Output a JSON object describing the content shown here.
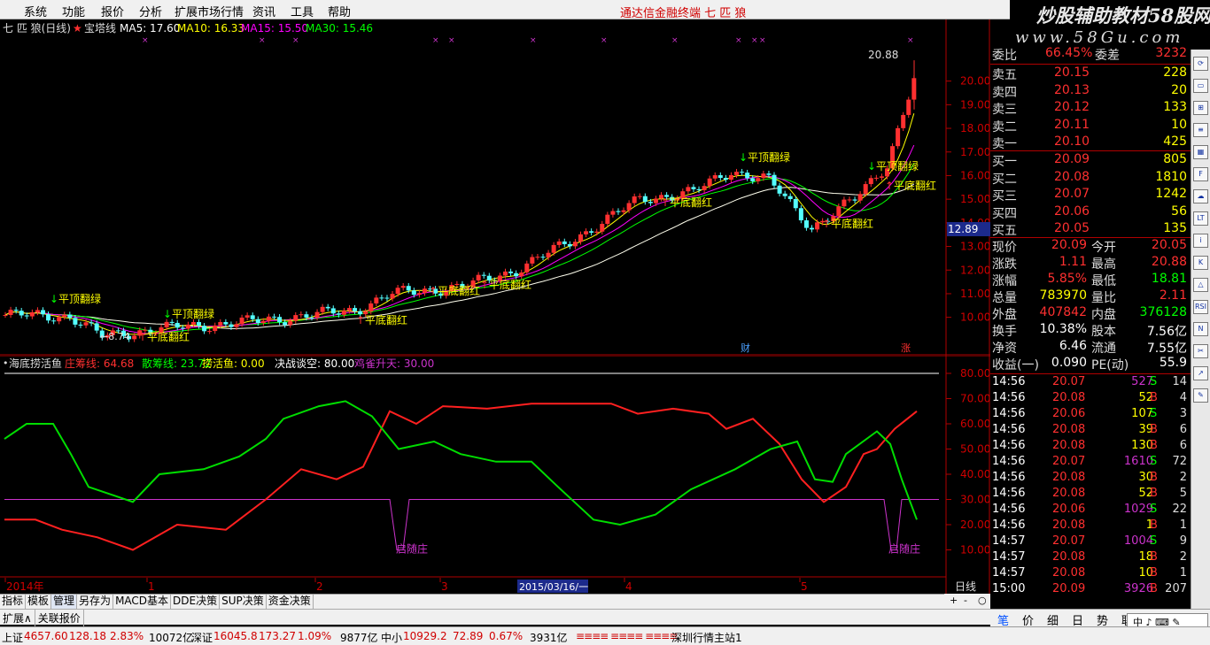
{
  "menu": [
    "系统",
    "功能",
    "报价",
    "分析",
    "扩展市场行情",
    "资讯",
    "工具",
    "帮助"
  ],
  "window_title": "通达信金融终端   七 匹 狼",
  "banner": {
    "line1": "炒股辅助教材58股网",
    "line2": "www.58Gu.com"
  },
  "chart_header": {
    "name": "七 匹 狼(日线)",
    "indicator": "宝塔线",
    "ma": [
      {
        "label": "MA5: 17.60",
        "color": "#ffffff"
      },
      {
        "label": "MA10: 16.33",
        "color": "#ffff00"
      },
      {
        "label": "MA15: 15.50",
        "color": "#ff00ff"
      },
      {
        "label": "MA30: 15.46",
        "color": "#00ff00"
      }
    ]
  },
  "price_axis": {
    "ticks": [
      "20.00",
      "19.00",
      "18.00",
      "17.00",
      "16.00",
      "15.00",
      "14.00",
      "13.00",
      "12.00",
      "11.00",
      "10.00"
    ],
    "current_tag": "12.89",
    "high_label": "20.88",
    "low_label": "8.74"
  },
  "annotations": {
    "top_flip": "平顶翻绿",
    "bottom_flip": "平底翻红",
    "markers": [
      "财",
      "涨"
    ]
  },
  "lower_header": {
    "name": "海底捞活鱼",
    "items": [
      {
        "label": "庄筹线: 64.68",
        "color": "#ff3030"
      },
      {
        "label": "散筹线: 23.72",
        "color": "#00ff00"
      },
      {
        "label": "捞活鱼: 0.00",
        "color": "#ffff00"
      },
      {
        "label": "决战谈空: 80.00",
        "color": "#ffffff"
      },
      {
        "label": "鸡雀升天: 30.00",
        "color": "#cc33cc"
      }
    ]
  },
  "lower_axis": {
    "ticks": [
      "80.00",
      "70.00",
      "60.00",
      "50.00",
      "40.00",
      "30.00",
      "20.00",
      "10.00"
    ]
  },
  "lower_labels": [
    "启随庄",
    "启随庄"
  ],
  "time_axis": {
    "labels": [
      "2014年",
      "1",
      "2",
      "3",
      "4",
      "5"
    ],
    "highlight": "2015/03/16/一",
    "period": "日线"
  },
  "bottom_tabs": [
    "指标",
    "模板",
    "管理",
    "另存为",
    "MACD基本",
    "DDE决策",
    "SUP决策",
    "资金决策"
  ],
  "bottom_tabs2": [
    "扩展∧",
    "关联报价"
  ],
  "zoom": [
    "+",
    "-",
    "○"
  ],
  "status": {
    "sh": "上证",
    "sh_val": "4657.60",
    "sh_chg": "128.18",
    "sh_pct": "2.83%",
    "sh_amt": "10072亿",
    "sz": "深证",
    "sz_val": "16045.8",
    "sz_chg": "173.27",
    "sz_pct": "1.09%",
    "sz_amt": "9877亿",
    "zx": "中小",
    "zx_val": "10929.2",
    "zx_chg": "72.89",
    "zx_pct": "0.67%",
    "zx_amt": "3931亿",
    "server": "深圳行情主站1"
  },
  "quote": {
    "weibi": {
      "label": "委比",
      "val": "66.45%",
      "label2": "委差",
      "val2": "3232"
    },
    "asks": [
      {
        "label": "卖五",
        "price": "20.15",
        "vol": "228"
      },
      {
        "label": "卖四",
        "price": "20.13",
        "vol": "20"
      },
      {
        "label": "卖三",
        "price": "20.12",
        "vol": "133"
      },
      {
        "label": "卖二",
        "price": "20.11",
        "vol": "10"
      },
      {
        "label": "卖一",
        "price": "20.10",
        "vol": "425"
      }
    ],
    "bids": [
      {
        "label": "买一",
        "price": "20.09",
        "vol": "805"
      },
      {
        "label": "买二",
        "price": "20.08",
        "vol": "1810"
      },
      {
        "label": "买三",
        "price": "20.07",
        "vol": "1242"
      },
      {
        "label": "买四",
        "price": "20.06",
        "vol": "56"
      },
      {
        "label": "买五",
        "price": "20.05",
        "vol": "135"
      }
    ],
    "stats": [
      {
        "l1": "现价",
        "v1": "20.09",
        "c1": "#ff3030",
        "l2": "今开",
        "v2": "20.05",
        "c2": "#ff3030"
      },
      {
        "l1": "涨跌",
        "v1": "1.11",
        "c1": "#ff3030",
        "l2": "最高",
        "v2": "20.88",
        "c2": "#ff3030"
      },
      {
        "l1": "涨幅",
        "v1": "5.85%",
        "c1": "#ff3030",
        "l2": "最低",
        "v2": "18.81",
        "c2": "#00ff00"
      },
      {
        "l1": "总量",
        "v1": "783970",
        "c1": "#ffff00",
        "l2": "量比",
        "v2": "2.11",
        "c2": "#ff3030"
      },
      {
        "l1": "外盘",
        "v1": "407842",
        "c1": "#ff3030",
        "l2": "内盘",
        "v2": "376128",
        "c2": "#00ff00"
      },
      {
        "l1": "换手",
        "v1": "10.38%",
        "c1": "#ffffff",
        "l2": "股本",
        "v2": "7.56亿",
        "c2": "#ffffff"
      },
      {
        "l1": "净资",
        "v1": "6.46",
        "c1": "#ffffff",
        "l2": "流通",
        "v2": "7.55亿",
        "c2": "#ffffff"
      },
      {
        "l1": "收益(一)",
        "v1": "0.090",
        "c1": "#ffffff",
        "l2": "PE(动)",
        "v2": "55.9",
        "c2": "#ffffff"
      }
    ],
    "trades": [
      {
        "t": "14:56",
        "p": "20.07",
        "v": "527",
        "s": "S",
        "n": "14"
      },
      {
        "t": "14:56",
        "p": "20.08",
        "v": "52",
        "s": "B",
        "n": "4"
      },
      {
        "t": "14:56",
        "p": "20.06",
        "v": "107",
        "s": "S",
        "n": "3"
      },
      {
        "t": "14:56",
        "p": "20.08",
        "v": "39",
        "s": "B",
        "n": "6"
      },
      {
        "t": "14:56",
        "p": "20.08",
        "v": "130",
        "s": "B",
        "n": "6"
      },
      {
        "t": "14:56",
        "p": "20.07",
        "v": "1610",
        "s": "S",
        "n": "72"
      },
      {
        "t": "14:56",
        "p": "20.08",
        "v": "30",
        "s": "B",
        "n": "2"
      },
      {
        "t": "14:56",
        "p": "20.08",
        "v": "52",
        "s": "B",
        "n": "5"
      },
      {
        "t": "14:56",
        "p": "20.06",
        "v": "1029",
        "s": "S",
        "n": "22"
      },
      {
        "t": "14:56",
        "p": "20.08",
        "v": "1",
        "s": "B",
        "n": "1"
      },
      {
        "t": "14:57",
        "p": "20.07",
        "v": "1004",
        "s": "S",
        "n": "9"
      },
      {
        "t": "14:57",
        "p": "20.08",
        "v": "18",
        "s": "B",
        "n": "2"
      },
      {
        "t": "14:57",
        "p": "20.08",
        "v": "10",
        "s": "B",
        "n": "1"
      },
      {
        "t": "15:00",
        "p": "20.09",
        "v": "3926",
        "s": "B",
        "n": "207"
      }
    ]
  },
  "right_tabs": [
    "笔",
    "价",
    "细",
    "日",
    "势",
    "联"
  ],
  "input_widget": "中 ♪ ⌨ ✎",
  "sidebar_icons": [
    "refresh-icon",
    "window-icon",
    "chart-icon",
    "list-icon",
    "grid-icon",
    "f10-icon",
    "cloud-icon",
    "lt-icon",
    "info-icon",
    "k-icon",
    "analyze-icon",
    "rsi-icon",
    "news-icon",
    "tool-icon",
    "arrow-icon",
    "pencil-icon"
  ],
  "sidebar_labels": [
    "⟳",
    "▭",
    "⊞",
    "≡",
    "▦",
    "F",
    "☁",
    "LT",
    "i",
    "K",
    "△",
    "RSI",
    "N",
    "✂",
    "↗",
    "✎"
  ]
}
